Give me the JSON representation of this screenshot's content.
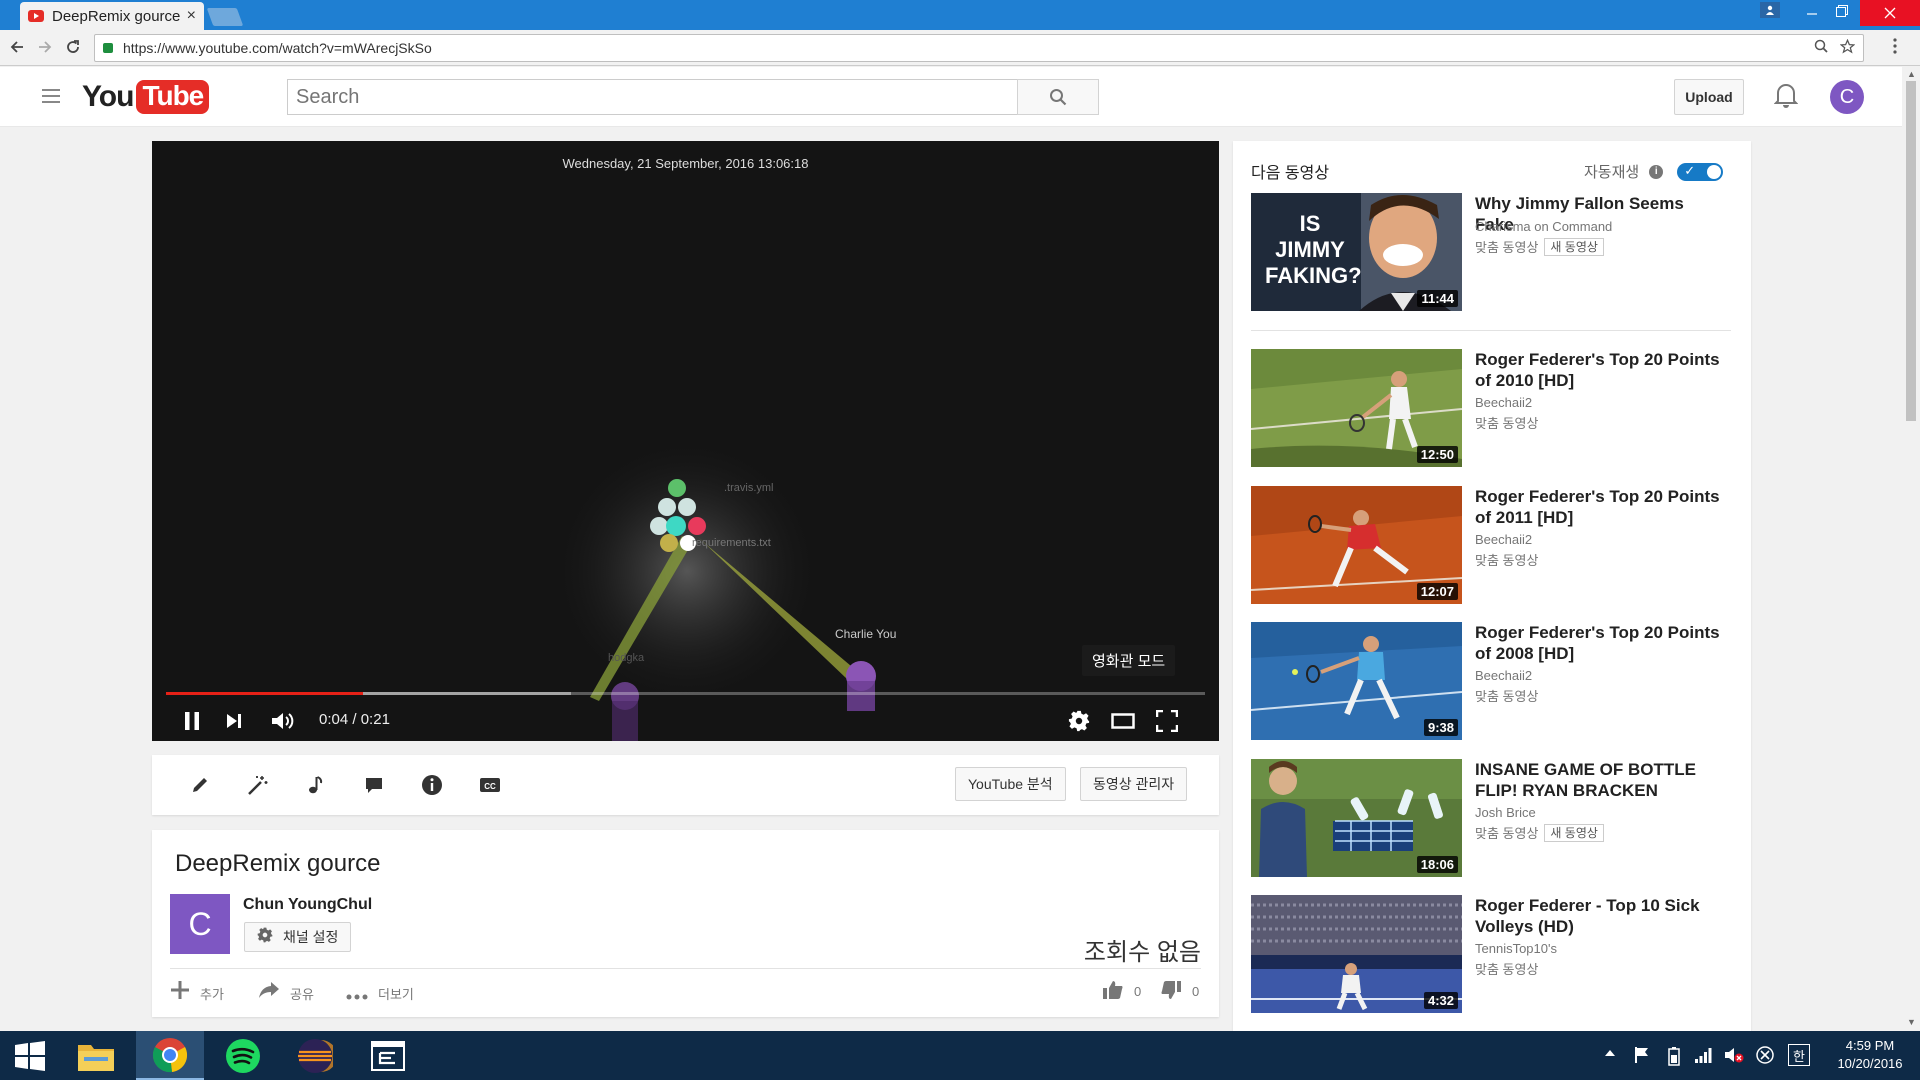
{
  "browser": {
    "tab_title": "DeepRemix gource",
    "tab_close": "×",
    "url": "https://www.youtube.com/watch?v=mWArecjSkSo"
  },
  "header": {
    "logo_you": "You",
    "logo_tube": "Tube",
    "search_placeholder": "Search",
    "upload_label": "Upload",
    "avatar_letter": "C"
  },
  "player": {
    "overlay_date": "Wednesday, 21 September, 2016 13:06:18",
    "labels": {
      "file1": ".travis.yml",
      "file2": "requirements.txt",
      "user1": "Charlie You",
      "user2": "hodgka"
    },
    "theater_tooltip": "영화관 모드",
    "time_current": "0:04",
    "time_separator": " / ",
    "time_total": "0:21",
    "progress": 0.19,
    "buffered": 0.39
  },
  "actionbar": {
    "analytics_label": "YouTube 분석",
    "manager_label": "동영상 관리자"
  },
  "video": {
    "title": "DeepRemix gource",
    "channel_name": "Chun YoungChul",
    "channel_avatar": "C",
    "channel_settings": "채널 설정",
    "views": "조회수 없음",
    "add_label": "추가",
    "share_label": "공유",
    "more_label": "더보기",
    "likes": "0",
    "dislikes": "0"
  },
  "sidebar": {
    "heading": "다음 동영상",
    "autoplay_label": "자동재생",
    "autoplay_on": true,
    "new_badge": "새 동영상",
    "items": [
      {
        "title": "Why Jimmy Fallon Seems Fake",
        "channel": "Charisma on Command",
        "meta": "맞춤 동영상",
        "duration": "11:44",
        "thumb_text": "IS JIMMY FAKING?"
      },
      {
        "title": "Roger Federer's Top 20 Points of 2010 [HD]",
        "channel": "Beechaii2",
        "meta": "맞춤 동영상",
        "duration": "12:50"
      },
      {
        "title": "Roger Federer's Top 20 Points of 2011 [HD]",
        "channel": "Beechaii2",
        "meta": "맞춤 동영상",
        "duration": "12:07"
      },
      {
        "title": "Roger Federer's Top 20 Points of 2008 [HD]",
        "channel": "Beechaii2",
        "meta": "맞춤 동영상",
        "duration": "9:38"
      },
      {
        "title": "INSANE GAME OF BOTTLE FLIP! RYAN BRACKEN",
        "channel": "Josh Brice",
        "meta": "맞춤 동영상",
        "duration": "18:06"
      },
      {
        "title": "Roger Federer - Top 10 Sick Volleys (HD)",
        "channel": "TennisTop10's",
        "meta": "맞춤 동영상",
        "duration": "4:32"
      }
    ]
  },
  "taskbar": {
    "ime": "한",
    "time": "4:59 PM",
    "date": "10/20/2016"
  },
  "colors": {
    "chrome_blue": "#1f7fd2",
    "youtube_red": "#e52d27",
    "autoplay_blue": "#167ac6",
    "avatar_purple": "#7e57c2",
    "taskbar": "#0e2a47"
  }
}
